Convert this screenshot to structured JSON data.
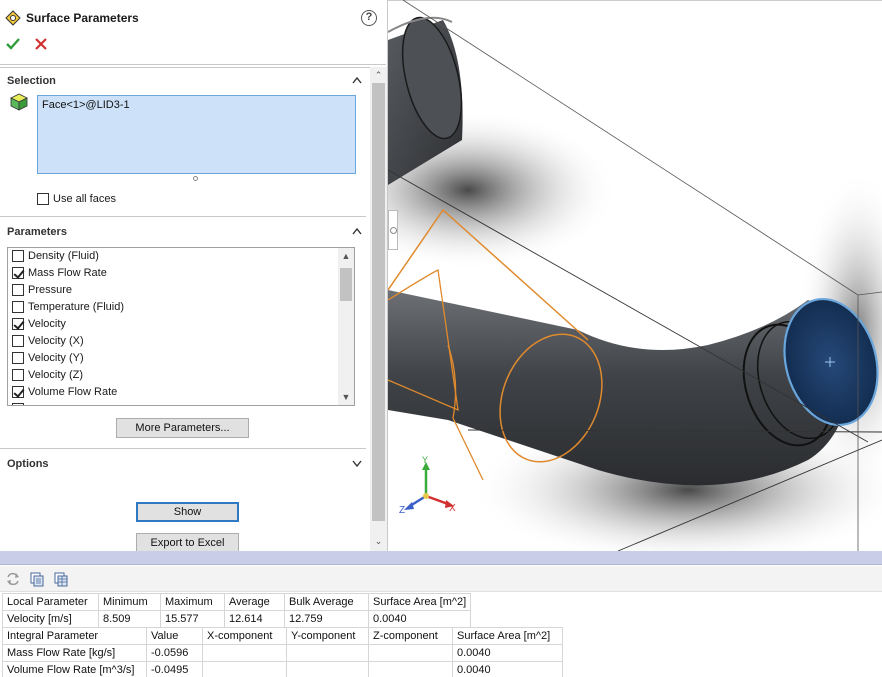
{
  "panel": {
    "title": "Surface Parameters",
    "help_glyph": "?",
    "ok_icon": "checkmark-icon",
    "cancel_icon": "close-icon",
    "selection": {
      "title": "Selection",
      "face": "Face<1>@LID3-1",
      "use_all_faces_label": "Use all faces",
      "use_all_faces_checked": false
    },
    "parameters": {
      "title": "Parameters",
      "items": [
        {
          "label": "Density (Fluid)",
          "checked": false
        },
        {
          "label": "Mass Flow Rate",
          "checked": true
        },
        {
          "label": "Pressure",
          "checked": false
        },
        {
          "label": "Temperature (Fluid)",
          "checked": false
        },
        {
          "label": "Velocity",
          "checked": true
        },
        {
          "label": "Velocity (X)",
          "checked": false
        },
        {
          "label": "Velocity (Y)",
          "checked": false
        },
        {
          "label": "Velocity (Z)",
          "checked": false
        },
        {
          "label": "Volume Flow Rate",
          "checked": true
        }
      ],
      "more_button": "More Parameters..."
    },
    "options": {
      "title": "Options"
    },
    "show_button": "Show",
    "export_button": "Export to Excel"
  },
  "viewport": {
    "triad_x": "X",
    "triad_y": "Y",
    "triad_z": "Z",
    "colors": {
      "pipe": "#3f4246",
      "edge_highlight": "#e08a2e",
      "selected_face": "#1f3f6a",
      "selected_edge": "#6aa6dc"
    }
  },
  "results": {
    "local_table": {
      "headers": [
        "Local Parameter",
        "Minimum",
        "Maximum",
        "Average",
        "Bulk Average",
        "Surface Area [m^2]"
      ],
      "rows": [
        [
          "Velocity [m/s]",
          "8.509",
          "15.577",
          "12.614",
          "12.759",
          "0.0040"
        ]
      ]
    },
    "integral_table": {
      "headers": [
        "Integral Parameter",
        "Value",
        "X-component",
        "Y-component",
        "Z-component",
        "Surface Area [m^2]"
      ],
      "rows": [
        [
          "Mass Flow Rate [kg/s]",
          "-0.0596",
          "",
          "",
          "",
          "0.0040"
        ],
        [
          "Volume Flow Rate [m^3/s]",
          "-0.0495",
          "",
          "",
          "",
          "0.0040"
        ]
      ]
    }
  }
}
